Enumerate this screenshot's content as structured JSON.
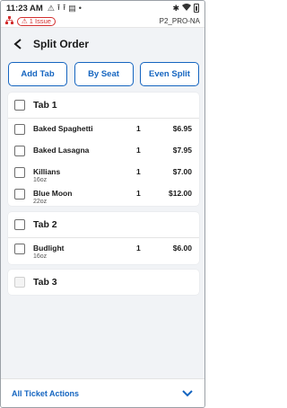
{
  "status_bar": {
    "time": "11:23 AM",
    "icons": [
      "warning-icon",
      "upload-icon",
      "upload-icon",
      "notification-icon",
      "dot-icon"
    ],
    "right_icons": [
      "bluetooth-icon",
      "wifi-icon",
      "battery-icon"
    ]
  },
  "info_bar": {
    "network_icon": "network-icon",
    "issue_label": "1 Issue",
    "issue_color": "#d32f2f",
    "device_name": "P2_PRO-NA"
  },
  "header": {
    "back_icon": "chevron-left-icon",
    "title": "Split Order"
  },
  "actions": [
    {
      "label": "Add Tab"
    },
    {
      "label": "By Seat"
    },
    {
      "label": "Even Split"
    }
  ],
  "accent_color": "#1565c0",
  "tabs": [
    {
      "title": "Tab 1",
      "items": [
        {
          "name": "Baked Spaghetti",
          "sub": "",
          "qty": "1",
          "price": "$6.95"
        },
        {
          "name": "Baked Lasagna",
          "sub": "",
          "qty": "1",
          "price": "$7.95"
        },
        {
          "name": "Killians",
          "sub": "16oz",
          "qty": "1",
          "price": "$7.00"
        },
        {
          "name": "Blue Moon",
          "sub": "22oz",
          "qty": "1",
          "price": "$12.00"
        }
      ]
    },
    {
      "title": "Tab 2",
      "items": [
        {
          "name": "Budlight",
          "sub": "16oz",
          "qty": "1",
          "price": "$6.00"
        }
      ]
    },
    {
      "title": "Tab 3",
      "items": []
    }
  ],
  "bottom_bar": {
    "label": "All Ticket Actions",
    "icon": "chevron-down-icon"
  }
}
